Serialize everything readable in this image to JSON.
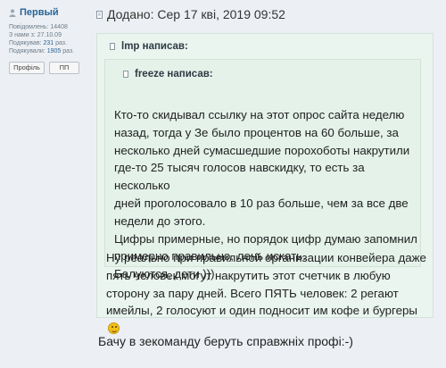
{
  "author": {
    "name": "Первый",
    "stats": [
      {
        "label": "Повідомлень:",
        "value": "14408",
        "link": false
      },
      {
        "label": "З нами з:",
        "value": "27.10.09",
        "link": false
      },
      {
        "label": "Подякував:",
        "value": "231",
        "suffix": "раз.",
        "link": true
      },
      {
        "label": "Подякували:",
        "value": "1905",
        "suffix": "раз.",
        "link": true
      }
    ],
    "buttons": {
      "profile": "Профіль",
      "pm": "ПП"
    }
  },
  "post": {
    "date": "Додано: Сер 17 кві, 2019 09:52",
    "reply": "Бачу в зекоманду беруть справжніх профі:-)"
  },
  "outer_quote": {
    "author": "lmp написав:",
    "lines": [
      "Ну реально при правильной организации конвейера даже",
      "пять человек могут накрутить этот счетчик в любую",
      "сторону за пару дней. Всего ПЯТЬ человек: 2 регают",
      "имейлы, 2 голосуют и один подносит им кофе и бургеры"
    ]
  },
  "inner_quote": {
    "author": "freeze написав:",
    "lines": [
      "Кто-то скидывал ссылку на этот опрос сайта неделю",
      "назад, тогда у Зе было процентов на 60 больше, за",
      "несколько дней сумасшедшие порохоботы накрутили",
      "где-то 25 тысяч голосов навскидку, то есть за несколько",
      "дней проголосовало в 10 раз больше, чем за все две",
      "недели до этого.",
      "Цифры примерные, но порядок цифр думаю запомнил",
      "примерно правильно, лень искать.",
      "Балуются, дети )))"
    ]
  },
  "icons": {
    "user": "user-icon",
    "post": "post-icon",
    "quote": "quote-icon",
    "smile": "smile-icon"
  },
  "colors": {
    "page_bg": "#ecf0f4",
    "quote_bg": "#e9f5ee",
    "link": "#2a6496"
  }
}
